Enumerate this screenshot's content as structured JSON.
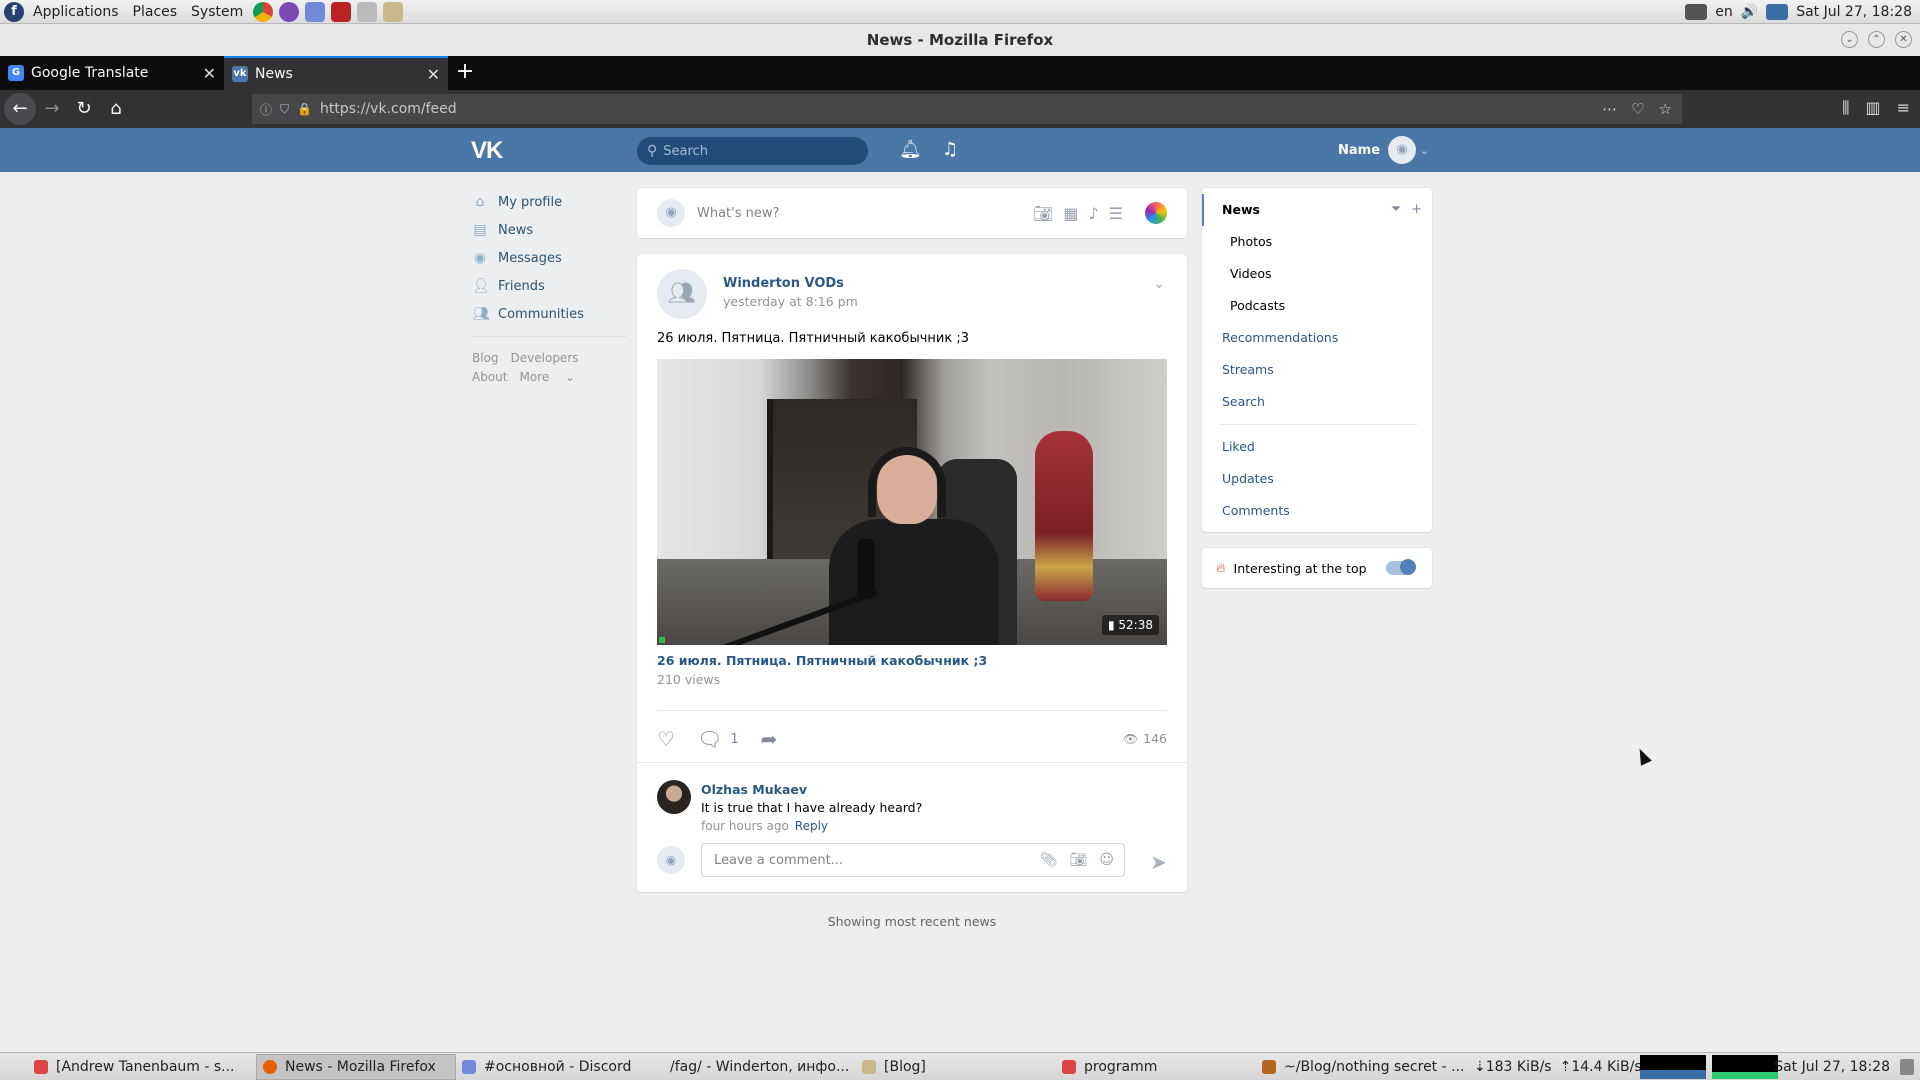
{
  "top_panel": {
    "menus": [
      "Applications",
      "Places",
      "System"
    ],
    "keyboard_layout": "en",
    "clock": "Sat Jul 27, 18:28"
  },
  "window": {
    "title": "News - Mozilla Firefox"
  },
  "tabs": [
    {
      "title": "Google Translate",
      "active": false
    },
    {
      "title": "News",
      "active": true
    }
  ],
  "url": "https://vk.com/feed",
  "vk_header": {
    "search_placeholder": "Search",
    "user_name": "Name"
  },
  "left_menu": {
    "items": [
      {
        "label": "My profile",
        "icon": "home-icon"
      },
      {
        "label": "News",
        "icon": "newspaper-icon"
      },
      {
        "label": "Messages",
        "icon": "chat-bubble-icon"
      },
      {
        "label": "Friends",
        "icon": "person-icon"
      },
      {
        "label": "Communities",
        "icon": "people-icon"
      }
    ],
    "footer": {
      "blog": "Blog",
      "developers": "Developers",
      "about": "About",
      "more": "More"
    }
  },
  "composer": {
    "placeholder": "What's new?"
  },
  "post": {
    "author": "Winderton VODs",
    "time": "yesterday at 8:16 pm",
    "text": "26 июля. Пятница. Пятничный какобычник ;3",
    "video": {
      "duration": "52:38",
      "title": "26 июля. Пятница. Пятничный какобычник ;3",
      "views": "210 views"
    },
    "comment_count": "1",
    "views": "146",
    "comment": {
      "author": "Olzhas Mukaev",
      "text": "It is true that I have already heard?",
      "time": "four hours ago",
      "reply_label": "Reply"
    },
    "reply_placeholder": "Leave a comment..."
  },
  "feed_end": "Showing most recent news",
  "right_nav": {
    "news": "News",
    "photos": "Photos",
    "videos": "Videos",
    "podcasts": "Podcasts",
    "recommendations": "Recommendations",
    "streams": "Streams",
    "search": "Search",
    "liked": "Liked",
    "updates": "Updates",
    "comments": "Comments"
  },
  "interesting": {
    "label": "Interesting at the top",
    "enabled": true
  },
  "taskbar": {
    "tasks": [
      "[Andrew Tanenbaum - s...",
      "News - Mozilla Firefox",
      "#основной - Discord",
      "/fag/ - Winderton, инфо...",
      "[Blog]",
      "programm",
      "~/Blog/nothing secret - ..."
    ],
    "download": "183 KiB/s",
    "upload": "14.4 KiB/s",
    "clock": "Sat Jul 27, 18:28"
  },
  "colors": {
    "vk_blue": "#4a76a8",
    "link": "#2a5885",
    "page_bg": "#edeef0",
    "firefox_dark": "#323234"
  }
}
